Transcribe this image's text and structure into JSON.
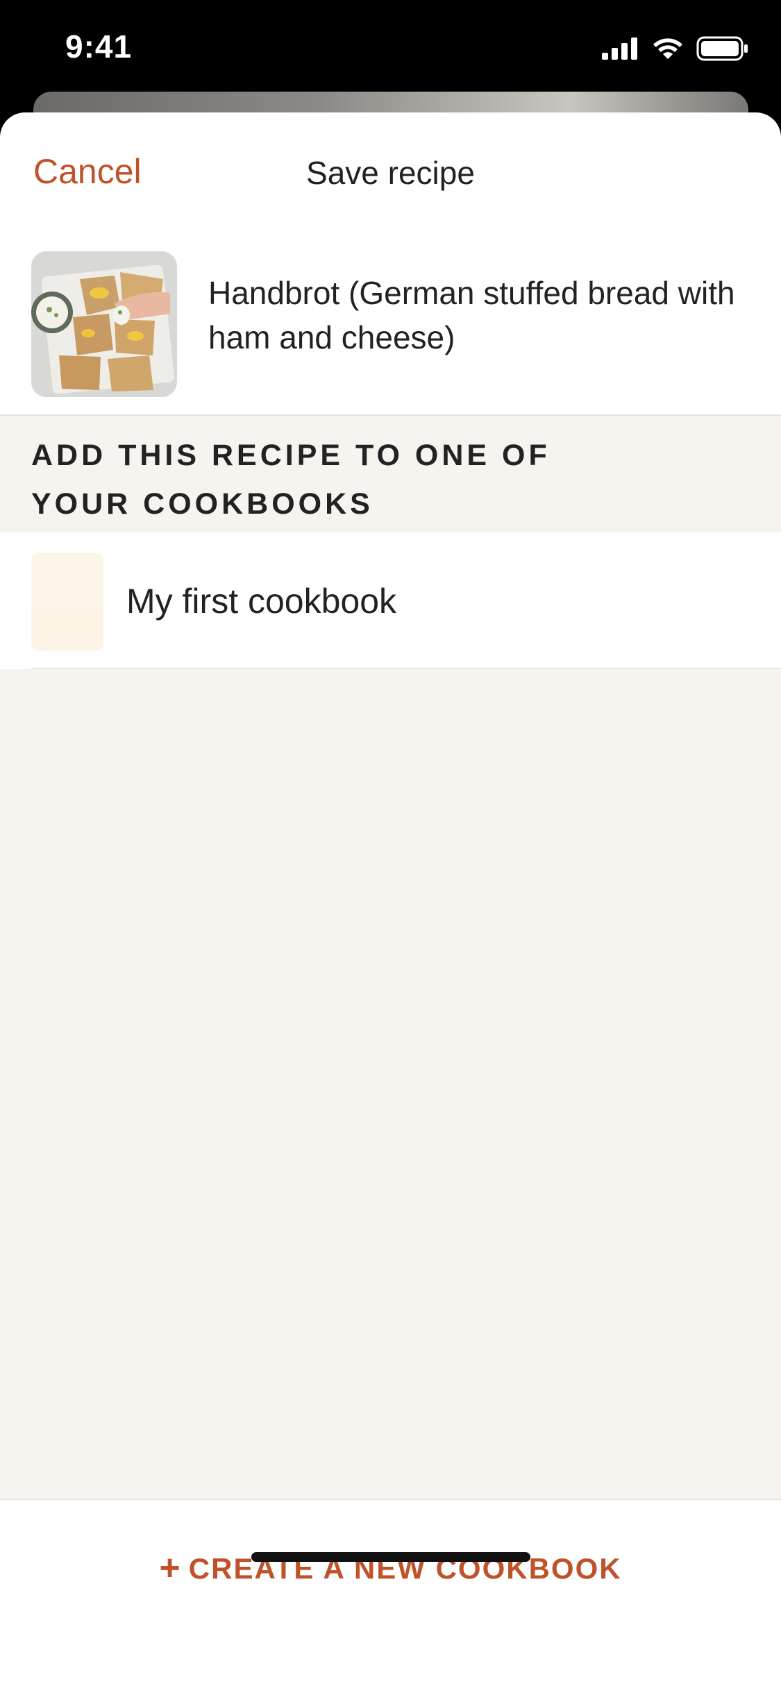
{
  "status_bar": {
    "time": "9:41",
    "icons": [
      "cellular-signal-icon",
      "wifi-icon",
      "battery-icon"
    ]
  },
  "nav": {
    "cancel_label": "Cancel",
    "title": "Save recipe"
  },
  "recipe": {
    "name": "Handbrot (German stuffed bread with ham and cheese)",
    "thumbnail": "recipe-photo"
  },
  "section": {
    "header": "ADD THIS RECIPE TO ONE OF YOUR COOKBOOKS"
  },
  "cookbooks": [
    {
      "name": "My first cookbook"
    }
  ],
  "footer": {
    "create_icon": "plus-icon",
    "create_label": "CREATE A NEW COOKBOOK"
  },
  "colors": {
    "accent": "#c0522a",
    "text": "#222222",
    "section_background": "#f7f4ef"
  }
}
